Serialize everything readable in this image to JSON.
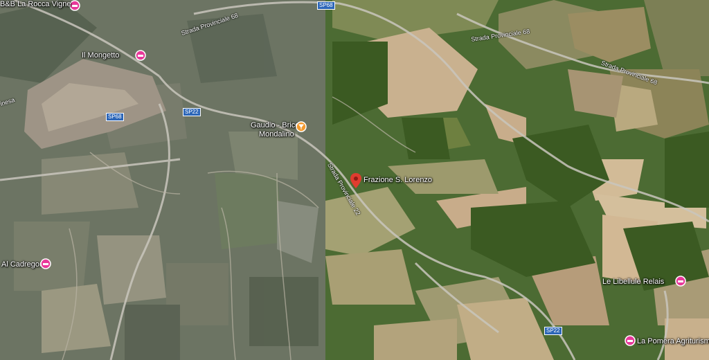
{
  "places": {
    "bb": "B&B La Rocca Vigne",
    "mongetto": "Il Mongetto",
    "gaudio_1": "Gaudio - Bricco",
    "gaudio_2": "Mondalino",
    "frazione": "Frazione S. Lorenzo",
    "cadregon": "Al Cadregon",
    "libellule": "Le Libellule Relais",
    "pomera": "La Pomera Agriturismo"
  },
  "roads": {
    "sp68_a": "SP68",
    "sp68_b": "SP68",
    "sp22_a": "SP22",
    "sp22_b": "SP22",
    "sp68_road_1": "Strada Provinciale 68",
    "sp68_road_2": "Strada Provinciale 68",
    "sp68_road_3": "Strada Provinciale 68",
    "sp22_road": "Strada Provinciale 22",
    "fragment": "inesa"
  },
  "colors": {
    "hotel_pin": "#e8399a",
    "food_pin": "#f29a2e",
    "location_pin": "#e03c2f",
    "road_shield": "#2c66b8"
  }
}
